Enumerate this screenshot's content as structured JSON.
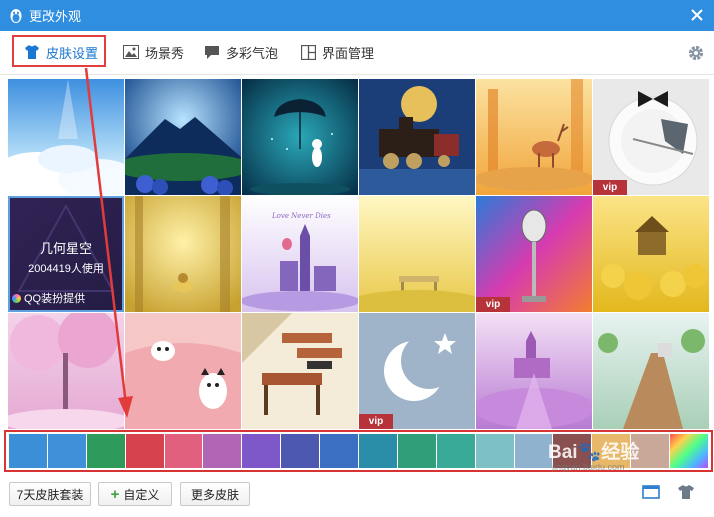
{
  "window": {
    "title": "更改外观",
    "close_icon": "close-icon"
  },
  "tabs": [
    {
      "label": "皮肤设置",
      "icon": "shirt-icon",
      "active": true
    },
    {
      "label": "场景秀",
      "icon": "picture-icon",
      "active": false
    },
    {
      "label": "多彩气泡",
      "icon": "chat-bubble-icon",
      "active": false
    },
    {
      "label": "界面管理",
      "icon": "layout-icon",
      "active": false
    }
  ],
  "settings_icon": "gear-icon",
  "skins": [
    {
      "theme": "sky-clouds",
      "vip": false
    },
    {
      "theme": "blue-mountain-flowers",
      "vip": false
    },
    {
      "theme": "rabbit-umbrella",
      "vip": false
    },
    {
      "theme": "night-train",
      "vip": false
    },
    {
      "theme": "golden-deer",
      "vip": false
    },
    {
      "theme": "plate-bowtie",
      "vip": true,
      "vip_label": "vip"
    },
    {
      "theme": "geometric-starry-sky",
      "vip": false
    },
    {
      "theme": "golden-forest",
      "vip": false
    },
    {
      "theme": "london-love",
      "vip": false,
      "caption": "Love Never Dies"
    },
    {
      "theme": "yellow-meadow-bench",
      "vip": false
    },
    {
      "theme": "microphone",
      "vip": true,
      "vip_label": "vip"
    },
    {
      "theme": "yellow-cottage",
      "vip": false
    },
    {
      "theme": "pink-blossom-tree",
      "vip": false
    },
    {
      "theme": "cats-pink",
      "vip": false
    },
    {
      "theme": "classroom-desks",
      "vip": false
    },
    {
      "theme": "moon-star",
      "vip": true,
      "vip_label": "vip"
    },
    {
      "theme": "purple-castle",
      "vip": false
    },
    {
      "theme": "green-boardwalk",
      "vip": false
    }
  ],
  "hover": {
    "name": "几何星空",
    "usage": "2004419人使用",
    "provider": "QQ装扮提供"
  },
  "swatches": [
    "#3a8fd6",
    "#3f90d8",
    "#2e9a5c",
    "#d6434e",
    "#e0607e",
    "#b066b4",
    "#7e57c9",
    "#4d58b0",
    "#3a6fc2",
    "#2a8ea8",
    "#2f9e79",
    "#3aaa98",
    "#7dc0c6",
    "#8fb3cf",
    "#8a5050",
    "#e8b86a",
    "#c9a89a",
    "rainbow"
  ],
  "buttons": {
    "seven_day": "7天皮肤套装",
    "custom": "自定义",
    "more": "更多皮肤"
  },
  "bottom_icons": [
    "window-icon",
    "shirt-icon"
  ],
  "colors": {
    "titlebar": "#2f8ee0",
    "active_tab": "#1a77d2",
    "highlight": "#d83434"
  },
  "watermark": {
    "brand": "Bai",
    "brand_cn": "经验",
    "url": "jingyan.baidu.com"
  }
}
